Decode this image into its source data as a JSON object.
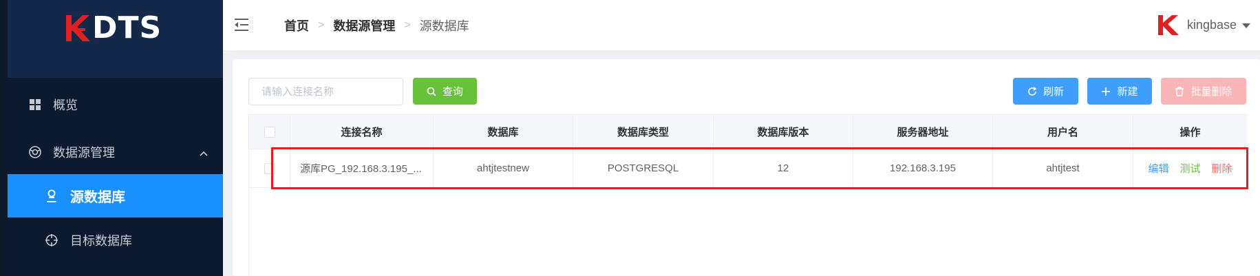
{
  "brand": {
    "logo_text": "DTS",
    "logo_color": "#e02020"
  },
  "sidebar": {
    "items": [
      {
        "label": "概览",
        "icon": "grid-icon"
      },
      {
        "label": "数据源管理",
        "icon": "datasource-icon",
        "expanded": true
      },
      {
        "label": "源数据库",
        "icon": "source-db-icon",
        "active": true
      },
      {
        "label": "目标数据库",
        "icon": "target-icon"
      }
    ],
    "active_color": "#1890ff"
  },
  "header": {
    "breadcrumb": [
      "首页",
      "数据源管理",
      "源数据库"
    ],
    "user": {
      "name": "kingbase"
    }
  },
  "toolbar": {
    "search_placeholder": "请输入连接名称",
    "search_value": "",
    "query_label": "查询",
    "refresh_label": "刷新",
    "new_label": "新建",
    "batch_delete_label": "批量删除"
  },
  "table": {
    "columns": [
      "连接名称",
      "数据库",
      "数据库类型",
      "数据库版本",
      "服务器地址",
      "用户名",
      "操作"
    ],
    "rows": [
      {
        "name": "源库PG_192.168.3.195_...",
        "database": "ahtjtestnew",
        "db_type": "POSTGRESQL",
        "db_version": "12",
        "server": "192.168.3.195",
        "username": "ahtjtest",
        "ops": {
          "edit": "编辑",
          "test": "测试",
          "delete": "删除"
        }
      }
    ]
  },
  "colors": {
    "primary": "#409eff",
    "success": "#67c23a",
    "danger": "#f56c6c",
    "danger_light": "#fab6b6",
    "sidebar_bg": "#0b1a2e"
  }
}
